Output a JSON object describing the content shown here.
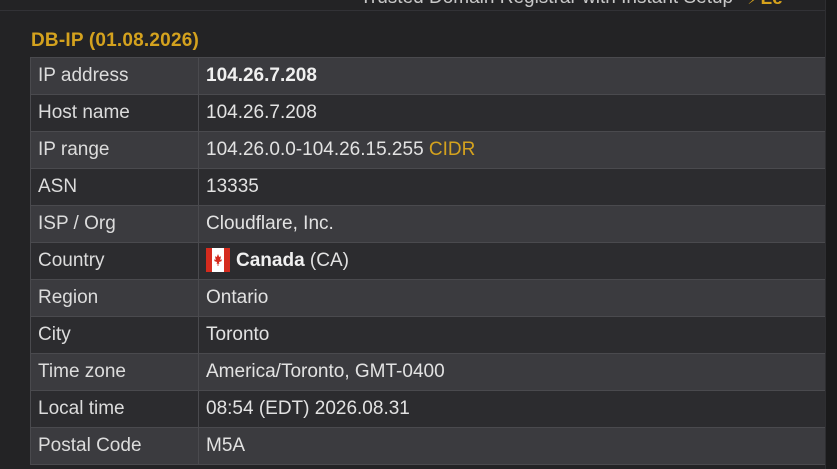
{
  "banner": {
    "text": "Trusted Domain Registrar with Instant Setup",
    "icon": "lightning-icon",
    "icon_glyph": "⚡",
    "trailing": "Le"
  },
  "section": {
    "title": "DB-IP (01.08.2026)"
  },
  "rows": {
    "ip": {
      "label": "IP address",
      "value": "104.26.7.208"
    },
    "host": {
      "label": "Host name",
      "value": "104.26.7.208"
    },
    "range": {
      "label": "IP range",
      "value": "104.26.0.0-104.26.15.255",
      "link": "CIDR"
    },
    "asn": {
      "label": "ASN",
      "value": "13335"
    },
    "isp": {
      "label": "ISP / Org",
      "value": "Cloudflare, Inc."
    },
    "country": {
      "label": "Country",
      "name": "Canada",
      "code": "(CA)",
      "flag_icon": "canada-flag-icon"
    },
    "region": {
      "label": "Region",
      "value": "Ontario"
    },
    "city": {
      "label": "City",
      "value": "Toronto"
    },
    "tz": {
      "label": "Time zone",
      "value": "America/Toronto, GMT-0400"
    },
    "time": {
      "label": "Local time",
      "value": "08:54 (EDT) 2026.08.31"
    },
    "postal": {
      "label": "Postal Code",
      "value": "M5A"
    }
  },
  "colors": {
    "accent": "#d4a21e",
    "row_odd": "#3b3b3f",
    "row_even": "#2c2c2f",
    "border": "#4a4a4e"
  }
}
